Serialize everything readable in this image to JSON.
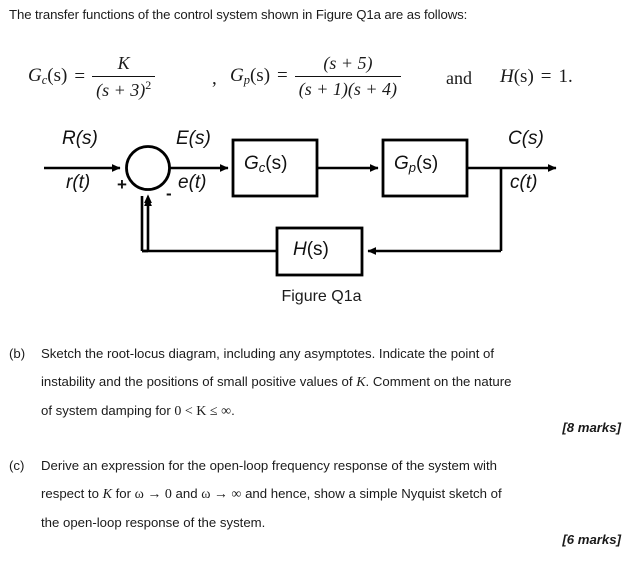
{
  "intro": {
    "text": "The transfer functions of the control system shown in Figure Q1a are as follows:"
  },
  "equations": {
    "gc": {
      "name": "G",
      "subscript": "c",
      "arg": "(s)",
      "equals": "=",
      "numerator": "K",
      "denominator": "(s + 3)",
      "den_exponent": "2"
    },
    "separator": ",",
    "gp": {
      "name": "G",
      "subscript": "p",
      "arg": "(s)",
      "equals": "=",
      "numerator": "(s + 5)",
      "denominator": "(s + 1)(s + 4)"
    },
    "conjunction": "and",
    "h": {
      "name": "H",
      "arg": "(s)",
      "equals": "=",
      "value": "1."
    }
  },
  "diagram": {
    "caption": "Figure Q1a",
    "input_label_top": "R(s)",
    "input_label_bottom": "r(t)",
    "error_label_top": "E(s)",
    "error_label_bottom": "e(t)",
    "output_label_top": "C(s)",
    "output_label_bottom": "c(t)",
    "plus_sign": "+",
    "minus_sign": "-",
    "blocks": {
      "controller": {
        "name": "G",
        "subscript": "c",
        "arg": "(s)"
      },
      "plant": {
        "name": "G",
        "subscript": "p",
        "arg": "(s)"
      },
      "feedback": {
        "name": "H",
        "arg": "(s)"
      }
    }
  },
  "questions": [
    {
      "label": "(b)",
      "line1": "Sketch the root-locus diagram, including any asymptotes. Indicate the point of",
      "line2_pre": "instability and the positions of small positive values of ",
      "line2_mi": "K",
      "line2_post": ". Comment on the nature",
      "line3_pre": "of system damping for ",
      "line3_math": "0 < K ≤ ∞",
      "line3_post": ".",
      "marks": "[8 marks]"
    },
    {
      "label": "(c)",
      "line1": "Derive an expression for the open-loop frequency response of the system with",
      "line2_pre": "respect to ",
      "line2_mi": "K",
      "line2_mid": " for ",
      "line2_math1": "ω → 0",
      "line2_mid2": " and ",
      "line2_math2": "ω → ∞",
      "line2_post": " and hence, show a simple Nyquist sketch of",
      "line3": "the open-loop response of the system.",
      "marks": "[6 marks]"
    }
  ],
  "colors": {
    "ink": "#1b1b1b",
    "line": "#000000",
    "background": "#ffffff"
  }
}
